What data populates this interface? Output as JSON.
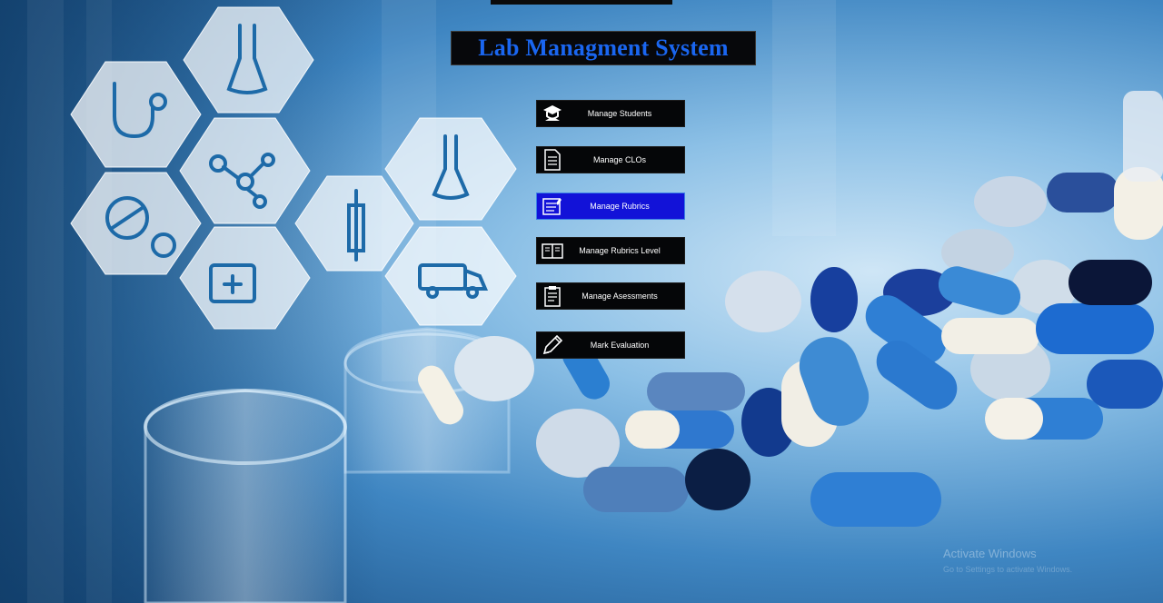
{
  "app": {
    "title": "Lab Managment System"
  },
  "menu": [
    {
      "label": "Manage Students",
      "icon": "student-cap-icon",
      "active": false
    },
    {
      "label": "Manage CLOs",
      "icon": "document-icon",
      "active": false
    },
    {
      "label": "Manage Rubrics",
      "icon": "rubric-icon",
      "active": true
    },
    {
      "label": "Manage Rubrics Level",
      "icon": "book-icon",
      "active": false
    },
    {
      "label": "Manage Asessments",
      "icon": "clipboard-icon",
      "active": false
    },
    {
      "label": "Mark Evaluation",
      "icon": "pencil-icon",
      "active": false
    }
  ],
  "watermark": {
    "line1": "Activate Windows",
    "line2": "Go to Settings to activate Windows."
  },
  "colors": {
    "title": "#1a66f0",
    "active_button": "#1212d8",
    "button": "#050608"
  }
}
